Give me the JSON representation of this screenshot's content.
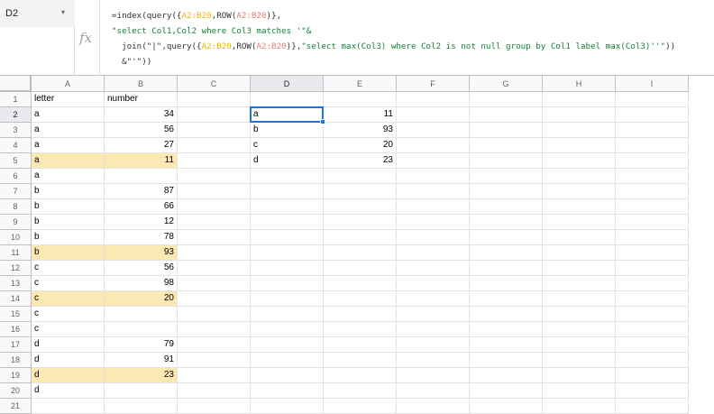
{
  "name_box": {
    "value": "D2",
    "dropdown_arrow": "▾"
  },
  "formula_bar": {
    "fx_label": "fx",
    "lines": [
      [
        {
          "t": "=index(query({",
          "c": ""
        },
        {
          "t": "A2:B20",
          "c": "ref"
        },
        {
          "t": ",ROW(",
          "c": ""
        },
        {
          "t": "A2:B20",
          "c": "ref2"
        },
        {
          "t": ")},",
          "c": ""
        }
      ],
      [
        {
          "t": "\"select Col1,Col2 where Col3 matches '\"&",
          "c": "str"
        }
      ],
      [
        {
          "t": "  join(\"|\",query({",
          "c": ""
        },
        {
          "t": "A2:B20",
          "c": "ref"
        },
        {
          "t": ",ROW(",
          "c": ""
        },
        {
          "t": "A2:B20",
          "c": "ref2"
        },
        {
          "t": ")},",
          "c": ""
        },
        {
          "t": "\"select max(Col3) where Col2 is not null group by Col1 label max(Col3)''\"",
          "c": "str"
        },
        {
          "t": "))",
          "c": ""
        }
      ],
      [
        {
          "t": "  &\"'\"))",
          "c": ""
        }
      ]
    ]
  },
  "columns": [
    "A",
    "B",
    "C",
    "D",
    "E",
    "F",
    "G",
    "H",
    "I"
  ],
  "selected_column": "D",
  "selected_row": 2,
  "rows": [
    {
      "n": "1",
      "A": "letter",
      "B": "number",
      "D": "",
      "E": ""
    },
    {
      "n": "2",
      "A": "a",
      "B": "34",
      "D": "a",
      "E": "11"
    },
    {
      "n": "3",
      "A": "a",
      "B": "56",
      "D": "b",
      "E": "93"
    },
    {
      "n": "4",
      "A": "a",
      "B": "27",
      "D": "c",
      "E": "20"
    },
    {
      "n": "5",
      "A": "a",
      "B": "11",
      "D": "d",
      "E": "23",
      "hl": true
    },
    {
      "n": "6",
      "A": "a",
      "B": "",
      "D": "",
      "E": ""
    },
    {
      "n": "7",
      "A": "b",
      "B": "87",
      "D": "",
      "E": ""
    },
    {
      "n": "8",
      "A": "b",
      "B": "66",
      "D": "",
      "E": ""
    },
    {
      "n": "9",
      "A": "b",
      "B": "12",
      "D": "",
      "E": ""
    },
    {
      "n": "10",
      "A": "b",
      "B": "78",
      "D": "",
      "E": ""
    },
    {
      "n": "11",
      "A": "b",
      "B": "93",
      "D": "",
      "E": "",
      "hl": true
    },
    {
      "n": "12",
      "A": "c",
      "B": "56",
      "D": "",
      "E": ""
    },
    {
      "n": "13",
      "A": "c",
      "B": "98",
      "D": "",
      "E": ""
    },
    {
      "n": "14",
      "A": "c",
      "B": "20",
      "D": "",
      "E": "",
      "hl": true
    },
    {
      "n": "15",
      "A": "c",
      "B": "",
      "D": "",
      "E": ""
    },
    {
      "n": "16",
      "A": "c",
      "B": "",
      "D": "",
      "E": ""
    },
    {
      "n": "17",
      "A": "d",
      "B": "79",
      "D": "",
      "E": ""
    },
    {
      "n": "18",
      "A": "d",
      "B": "91",
      "D": "",
      "E": ""
    },
    {
      "n": "19",
      "A": "d",
      "B": "23",
      "D": "",
      "E": "",
      "hl": true
    },
    {
      "n": "20",
      "A": "d",
      "B": "",
      "D": "",
      "E": ""
    },
    {
      "n": "21",
      "A": "",
      "B": "",
      "D": "",
      "E": ""
    }
  ]
}
